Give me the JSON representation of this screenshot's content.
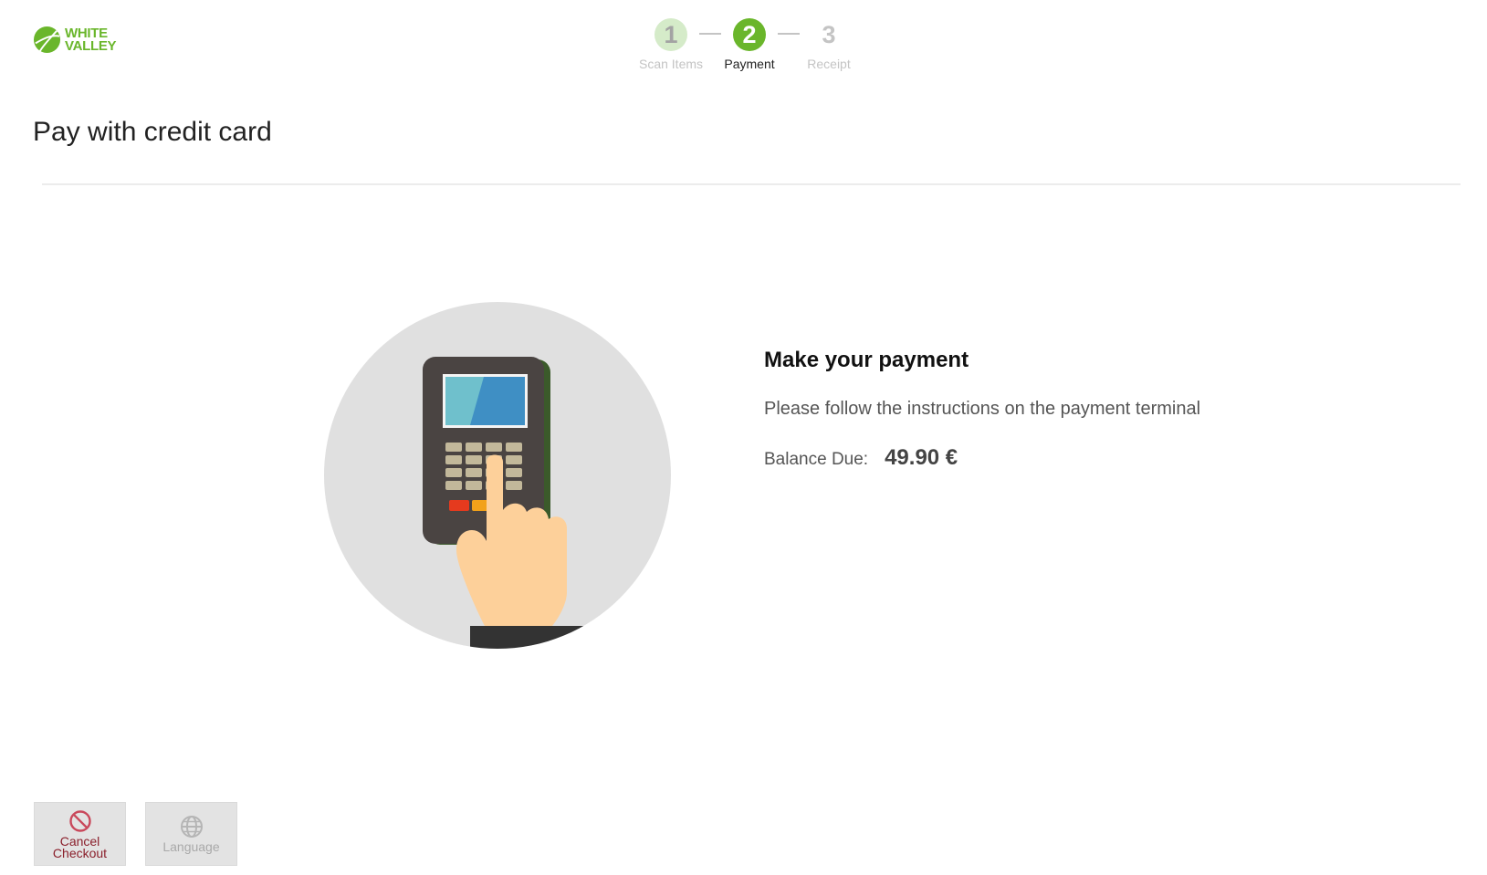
{
  "brand": {
    "line1": "WHITE",
    "line2": "VALLEY",
    "color": "#6ab62b"
  },
  "stepper": {
    "steps": [
      {
        "number": "1",
        "label": "Scan Items",
        "state": "completed"
      },
      {
        "number": "2",
        "label": "Payment",
        "state": "active"
      },
      {
        "number": "3",
        "label": "Receipt",
        "state": "pending"
      }
    ],
    "active_color": "#6ab62b"
  },
  "page": {
    "title": "Pay with credit card"
  },
  "payment": {
    "heading": "Make your payment",
    "instructions": "Please follow the instructions on the payment terminal",
    "balance_label": "Balance Due:",
    "balance_value": "49.90 €"
  },
  "footer": {
    "cancel": {
      "line1": "Cancel",
      "line2": "Checkout",
      "icon": "cancel-icon",
      "color": "#8a1f2b"
    },
    "language": {
      "label": "Language",
      "icon": "globe-icon"
    }
  }
}
